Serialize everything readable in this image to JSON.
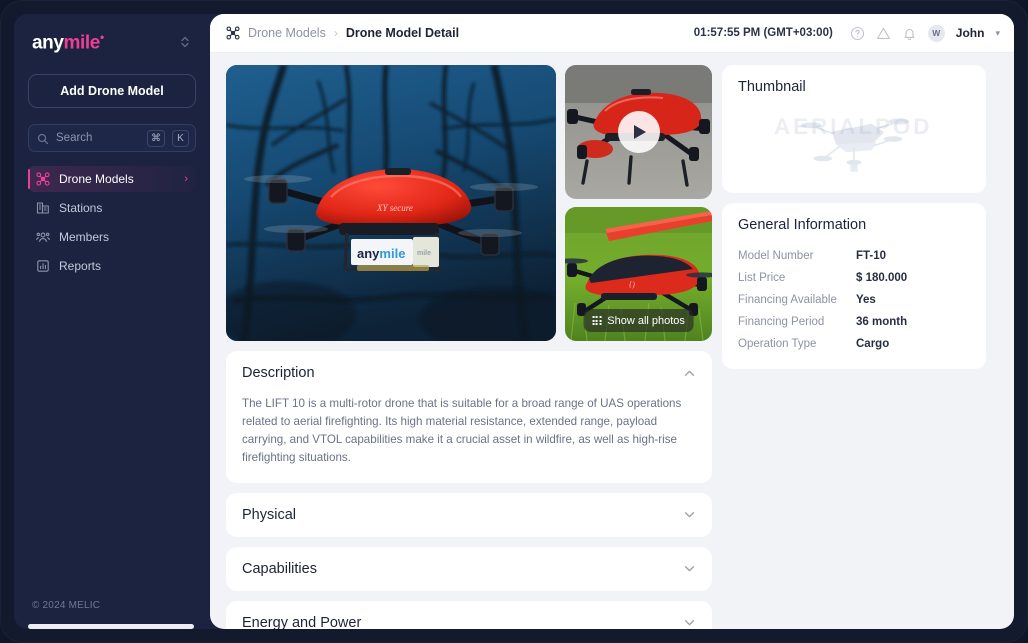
{
  "sidebar": {
    "logo": {
      "part1": "any",
      "part2": "mile",
      "mark": "•"
    },
    "switch_icon": "chevron-updown-icon",
    "add_button": "Add Drone Model",
    "search": {
      "placeholder": "Search",
      "kbd1": "⌘",
      "kbd2": "K",
      "icon": "search-icon"
    },
    "items": [
      {
        "label": "Drone Models",
        "icon": "drone-icon",
        "active": true,
        "chevron": "›"
      },
      {
        "label": "Stations",
        "icon": "building-icon",
        "active": false
      },
      {
        "label": "Members",
        "icon": "members-icon",
        "active": false
      },
      {
        "label": "Reports",
        "icon": "chart-bar-icon",
        "active": false
      }
    ],
    "footer": "© 2024 MELIC"
  },
  "topbar": {
    "breadcrumb_icon": "drone-icon",
    "breadcrumb_parent": "Drone Models",
    "breadcrumb_sep": "›",
    "breadcrumb_current": "Drone Model Detail",
    "clock": "01:57:55 PM (GMT+03:00)",
    "help_icon": "question-circle-icon",
    "alert_icon": "warning-triangle-icon",
    "bell_icon": "bell-icon",
    "avatar_initial": "W",
    "user_name": "John",
    "user_caret": "▾"
  },
  "media": {
    "hero_alt": "red-delivery-drone-in-flight",
    "video_thumb_alt": "red-drone-on-tarmac",
    "photo_thumb_alt": "red-drone-on-grass",
    "play_icon": "play-icon",
    "show_all_label": "Show all photos",
    "show_all_icon": "grid-icon"
  },
  "sections": [
    {
      "title": "Description",
      "expanded": true,
      "caret": "chevron-up-icon",
      "body": "The LIFT 10 is a multi-rotor drone that is suitable for a broad range of UAS operations related to aerial firefighting. Its high material resistance, extended range, payload carrying, and VTOL capabilities make it a crucial asset in wildfire, as well as high-rise firefighting situations."
    },
    {
      "title": "Physical",
      "expanded": false,
      "caret": "chevron-down-icon",
      "body": ""
    },
    {
      "title": "Capabilities",
      "expanded": false,
      "caret": "chevron-down-icon",
      "body": ""
    },
    {
      "title": "Energy and Power",
      "expanded": false,
      "caret": "chevron-down-icon",
      "body": ""
    }
  ],
  "thumbnail_card": {
    "title": "Thumbnail",
    "art": "drone-silhouette-watermark"
  },
  "general_info": {
    "title": "General Information",
    "rows": [
      {
        "key": "Model Number",
        "value": "FT-10"
      },
      {
        "key": "List Price",
        "value": "$ 180.000"
      },
      {
        "key": "Financing Available",
        "value": "Yes"
      },
      {
        "key": "Financing Period",
        "value": "36 month"
      },
      {
        "key": "Operation Type",
        "value": "Cargo"
      }
    ]
  },
  "colors": {
    "sidebar_bg": "#1b2340",
    "accent_pink": "#ec3f96",
    "page_bg": "#f2f3f7",
    "card_bg": "#ffffff",
    "text_dark": "#1d2438",
    "text_muted": "#8d93a6"
  }
}
